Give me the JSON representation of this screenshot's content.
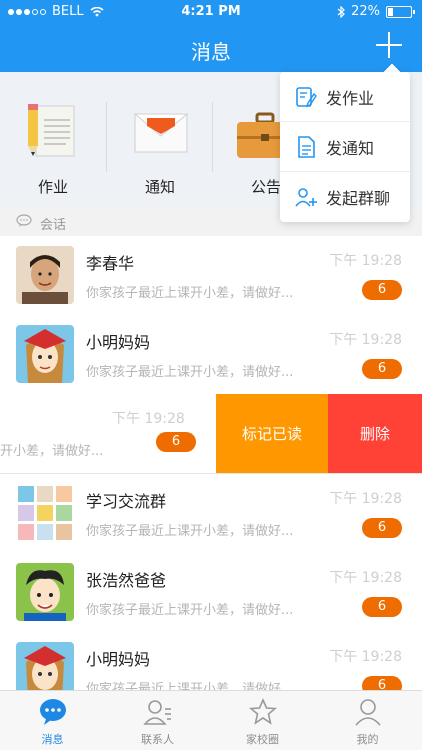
{
  "status_bar": {
    "carrier": "BELL",
    "time": "4:21 PM",
    "battery": "22%"
  },
  "header": {
    "title": "消息"
  },
  "categories": [
    {
      "label": "作业",
      "icon": "homework-icon"
    },
    {
      "label": "通知",
      "icon": "mail-icon"
    },
    {
      "label": "公告",
      "icon": "briefcase-icon"
    }
  ],
  "section": {
    "label": "会话"
  },
  "popup_menu": {
    "items": [
      {
        "label": "发作业",
        "icon": "edit-icon"
      },
      {
        "label": "发通知",
        "icon": "document-icon"
      },
      {
        "label": "发起群聊",
        "icon": "add-user-icon"
      }
    ]
  },
  "conversations": [
    {
      "name": "李春华",
      "time": "下午 19:28",
      "preview": "你家孩子最近上课开小差，请做好...",
      "badge": "6"
    },
    {
      "name": "小明妈妈",
      "time": "下午 19:28",
      "preview": "你家孩子最近上课开小差，请做好...",
      "badge": "6"
    },
    {
      "name": "",
      "time": "下午 19:28",
      "preview": "开小差，请做好...",
      "badge": "6",
      "actions": {
        "mark_read": "标记已读",
        "delete": "删除"
      }
    },
    {
      "name": "学习交流群",
      "time": "下午 19:28",
      "preview": "你家孩子最近上课开小差，请做好...",
      "badge": "6"
    },
    {
      "name": "张浩然爸爸",
      "time": "下午 19:28",
      "preview": "你家孩子最近上课开小差，请做好...",
      "badge": "6"
    },
    {
      "name": "小明妈妈",
      "time": "下午 19:28",
      "preview": "你家孩子最近上课开小差，请做好...",
      "badge": "6"
    }
  ],
  "tabbar": [
    {
      "label": "消息",
      "icon": "chat-bubble-icon",
      "active": true
    },
    {
      "label": "联系人",
      "icon": "contacts-icon",
      "active": false
    },
    {
      "label": "家校圈",
      "icon": "star-icon",
      "active": false
    },
    {
      "label": "我的",
      "icon": "profile-icon",
      "active": false
    }
  ],
  "colors": {
    "primary": "#2196f3",
    "badge": "#ef6c00",
    "mark_read": "#ff9800",
    "delete": "#ff4136"
  }
}
